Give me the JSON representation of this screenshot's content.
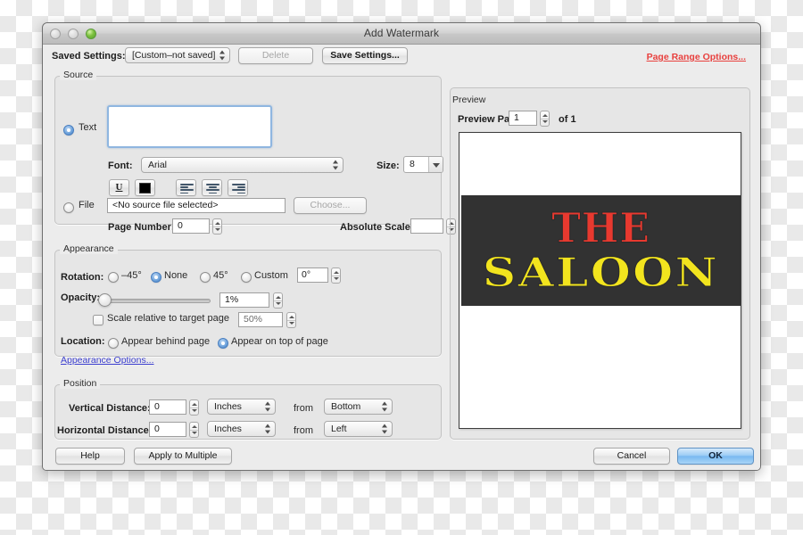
{
  "window": {
    "title": "Add Watermark",
    "traffic_lights": [
      "close-button",
      "minimize-button",
      "zoom-button"
    ]
  },
  "toolbar": {
    "saved_settings_label": "Saved Settings:",
    "saved_settings_value": "[Custom–not saved]",
    "delete_label": "Delete",
    "save_settings_label": "Save Settings...",
    "page_range_options_label": "Page Range Options..."
  },
  "source": {
    "title": "Source",
    "text_radio_label": "Text",
    "text_value": "",
    "font_label": "Font:",
    "font_value": "Arial",
    "size_label": "Size:",
    "size_value": "8",
    "format_buttons": [
      {
        "name": "underline-button",
        "glyph": "U"
      },
      {
        "name": "text-color-button",
        "swatch": "#000000"
      },
      {
        "name": "align-left-button"
      },
      {
        "name": "align-center-button"
      },
      {
        "name": "align-right-button"
      }
    ],
    "file_radio_label": "File",
    "file_value": "<No source file selected>",
    "choose_label": "Choose...",
    "page_number_label": "Page Number:",
    "page_number_value": "0",
    "absolute_scale_label": "Absolute Scale:",
    "absolute_scale_value": ""
  },
  "appearance": {
    "title": "Appearance",
    "rotation_label": "Rotation:",
    "rotation_options": [
      "–45°",
      "None",
      "45°",
      "Custom"
    ],
    "rotation_selected": "None",
    "rotation_custom_value": "0°",
    "opacity_label": "Opacity:",
    "opacity_value": "1%",
    "opacity_percent": 1,
    "scale_checkbox_label": "Scale relative to target page",
    "scale_checkbox_checked": false,
    "scale_value": "50%",
    "location_label": "Location:",
    "location_behind_label": "Appear behind page",
    "location_top_label": "Appear on top of page",
    "location_selected": "Appear on top of page",
    "appearance_options_link": "Appearance Options..."
  },
  "position": {
    "title": "Position",
    "vertical_label": "Vertical Distance:",
    "vertical_value": "0",
    "vertical_unit": "Inches",
    "vertical_from": "from",
    "vertical_anchor": "Bottom",
    "horizontal_label": "Horizontal Distance:",
    "horizontal_value": "0",
    "horizontal_unit": "Inches",
    "horizontal_from": "from",
    "horizontal_anchor": "Left"
  },
  "preview": {
    "title": "Preview",
    "page_label": "Preview Page",
    "page_value": "1",
    "of_label": "of 1",
    "artwork": {
      "line1": "THE",
      "line2": "SALOON",
      "background_color": "#323232",
      "line1_color": "#e8392f",
      "line2_color": "#f2e41e"
    }
  },
  "footer": {
    "help_label": "Help",
    "apply_multiple_label": "Apply to Multiple",
    "cancel_label": "Cancel",
    "ok_label": "OK"
  }
}
